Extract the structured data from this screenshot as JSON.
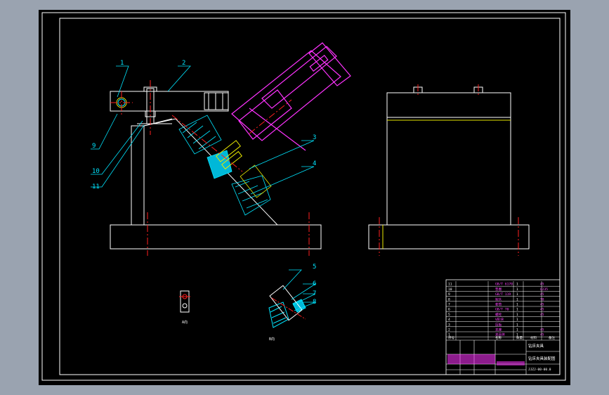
{
  "colors": {
    "background": "#000000",
    "frame": "#ffffff",
    "leader": "#00e5ff",
    "center": "#ff2020",
    "part_magenta": "#ff33ff",
    "yellow": "#e8e800",
    "hatch": "#00e5ff",
    "table_text": "#ff44ff"
  },
  "balloons": [
    "1",
    "2",
    "3",
    "4",
    "5",
    "6",
    "7",
    "8",
    "9",
    "10",
    "11"
  ],
  "views": {
    "view_a_label": "A向",
    "view_b_label": "B向"
  },
  "title_block": {
    "part_rows": [
      {
        "no": "11",
        "name": "GB/T 6170",
        "qty": "1",
        "material": "45"
      },
      {
        "no": "10",
        "name": "垫圈",
        "qty": "1",
        "material": "Q235"
      },
      {
        "no": "9",
        "name": "GB/T 119",
        "qty": "1",
        "material": "45"
      },
      {
        "no": "8",
        "name": "钩头",
        "qty": "1",
        "material": "T8"
      },
      {
        "no": "7",
        "name": "套筒",
        "qty": "1",
        "material": "45"
      },
      {
        "no": "6",
        "name": "GB/T 70",
        "qty": "1",
        "material": "45"
      },
      {
        "no": "5",
        "name": "螺栓",
        "qty": "1",
        "material": "45"
      },
      {
        "no": "4",
        "name": "V形块",
        "qty": "1",
        "material": ""
      },
      {
        "no": "3",
        "name": "压板",
        "qty": "1",
        "material": ""
      },
      {
        "no": "2",
        "name": "支座",
        "qty": "1",
        "material": "45"
      },
      {
        "no": "1",
        "name": "夹具体",
        "qty": "1",
        "material": "45"
      }
    ],
    "header": {
      "no": "序号",
      "name": "名称",
      "qty": "数量",
      "material": "材料",
      "remark": "备注"
    },
    "school": "钻床夹具",
    "drawing_title": "钻床夹具装配图",
    "drawing_number": "JJZJ-00-00.0"
  }
}
